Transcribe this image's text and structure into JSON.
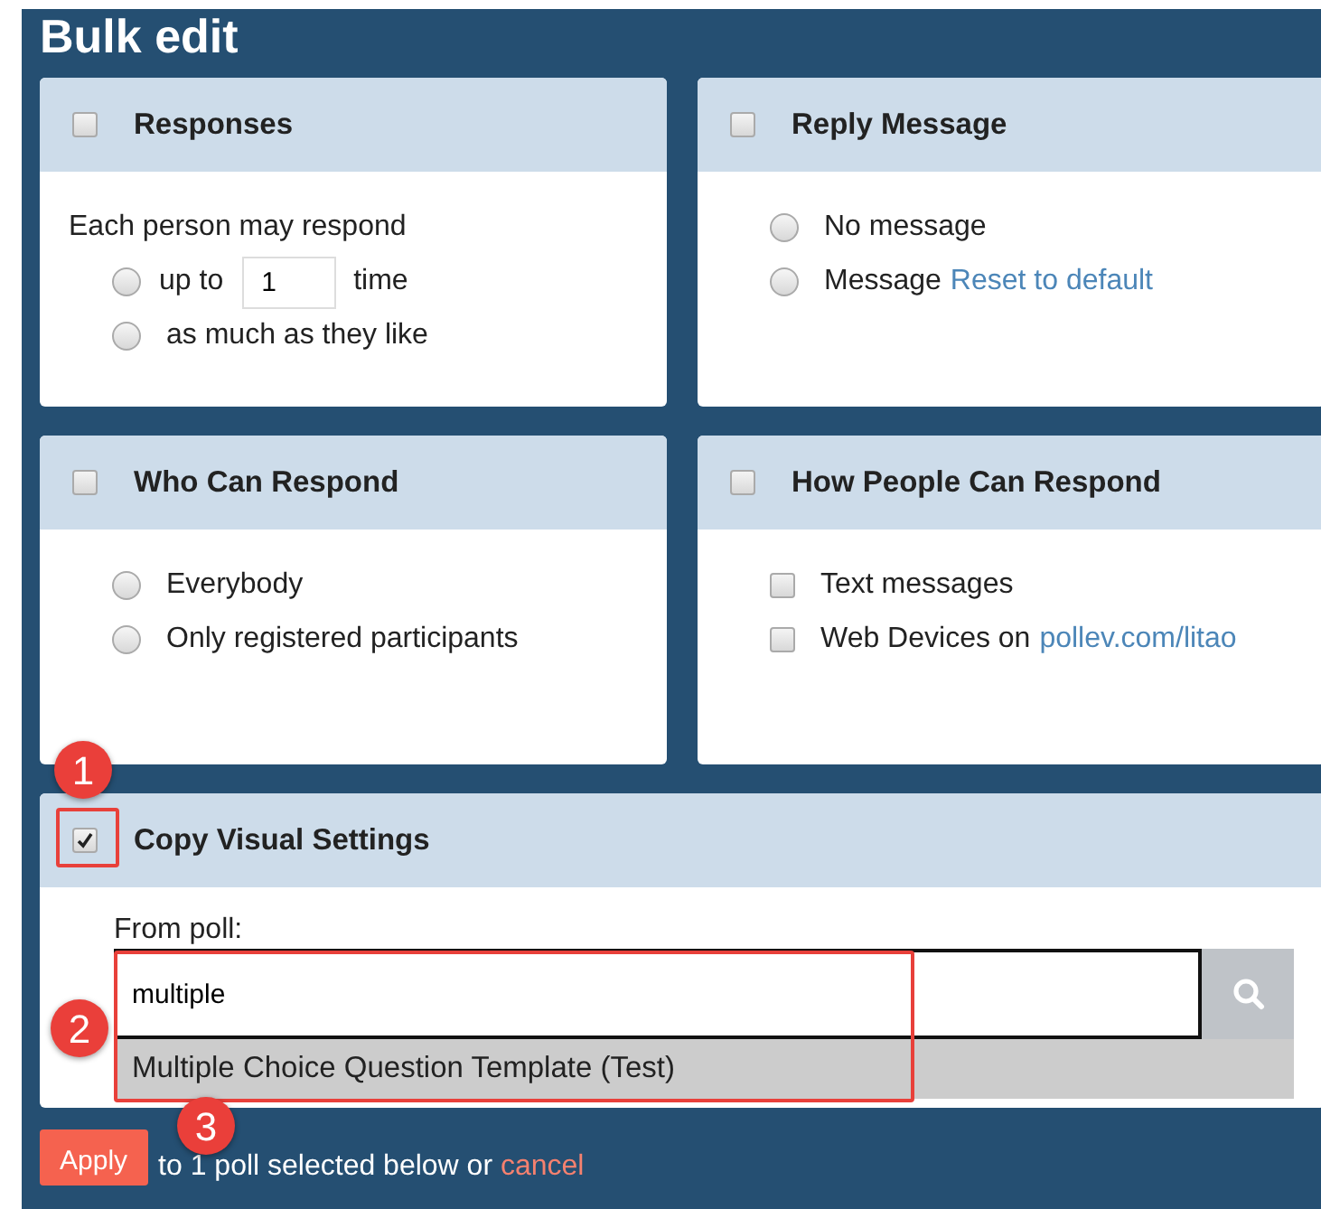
{
  "title": "Bulk edit",
  "cards": [
    {
      "title": "Responses",
      "checked": false,
      "rows": [
        {
          "kind": "text",
          "label": "Each person may respond"
        },
        {
          "kind": "radio-input",
          "prefix": "up to",
          "value": "1",
          "suffix": "time",
          "selected": false
        },
        {
          "kind": "radio",
          "label": "as much as they like",
          "selected": false
        }
      ]
    },
    {
      "title": "Reply Message",
      "checked": false,
      "rows": [
        {
          "kind": "radio",
          "label": "No message",
          "selected": false
        },
        {
          "kind": "radio",
          "label": "Message",
          "link": "Reset to default",
          "selected": false
        }
      ]
    },
    {
      "title": "Who Can Respond",
      "checked": false,
      "rows": [
        {
          "kind": "radio",
          "label": "Everybody",
          "selected": false
        },
        {
          "kind": "radio",
          "label": "Only registered participants",
          "selected": false
        }
      ]
    },
    {
      "title": "How People Can Respond",
      "checked": false,
      "rows": [
        {
          "kind": "checkbox",
          "label": "Text messages",
          "checked": false
        },
        {
          "kind": "checkbox",
          "label": "Web Devices on",
          "link": "pollev.com/litao",
          "checked": false
        }
      ]
    }
  ],
  "copy_settings": {
    "title": "Copy Visual Settings",
    "checked": true,
    "from_label": "From poll:",
    "search_value": "multiple",
    "suggestion": "Multiple Choice Question Template (Test)"
  },
  "footer": {
    "button": "Apply",
    "text": "to 1 poll selected below or",
    "link": "cancel"
  },
  "annotations": [
    "1",
    "2",
    "3"
  ]
}
